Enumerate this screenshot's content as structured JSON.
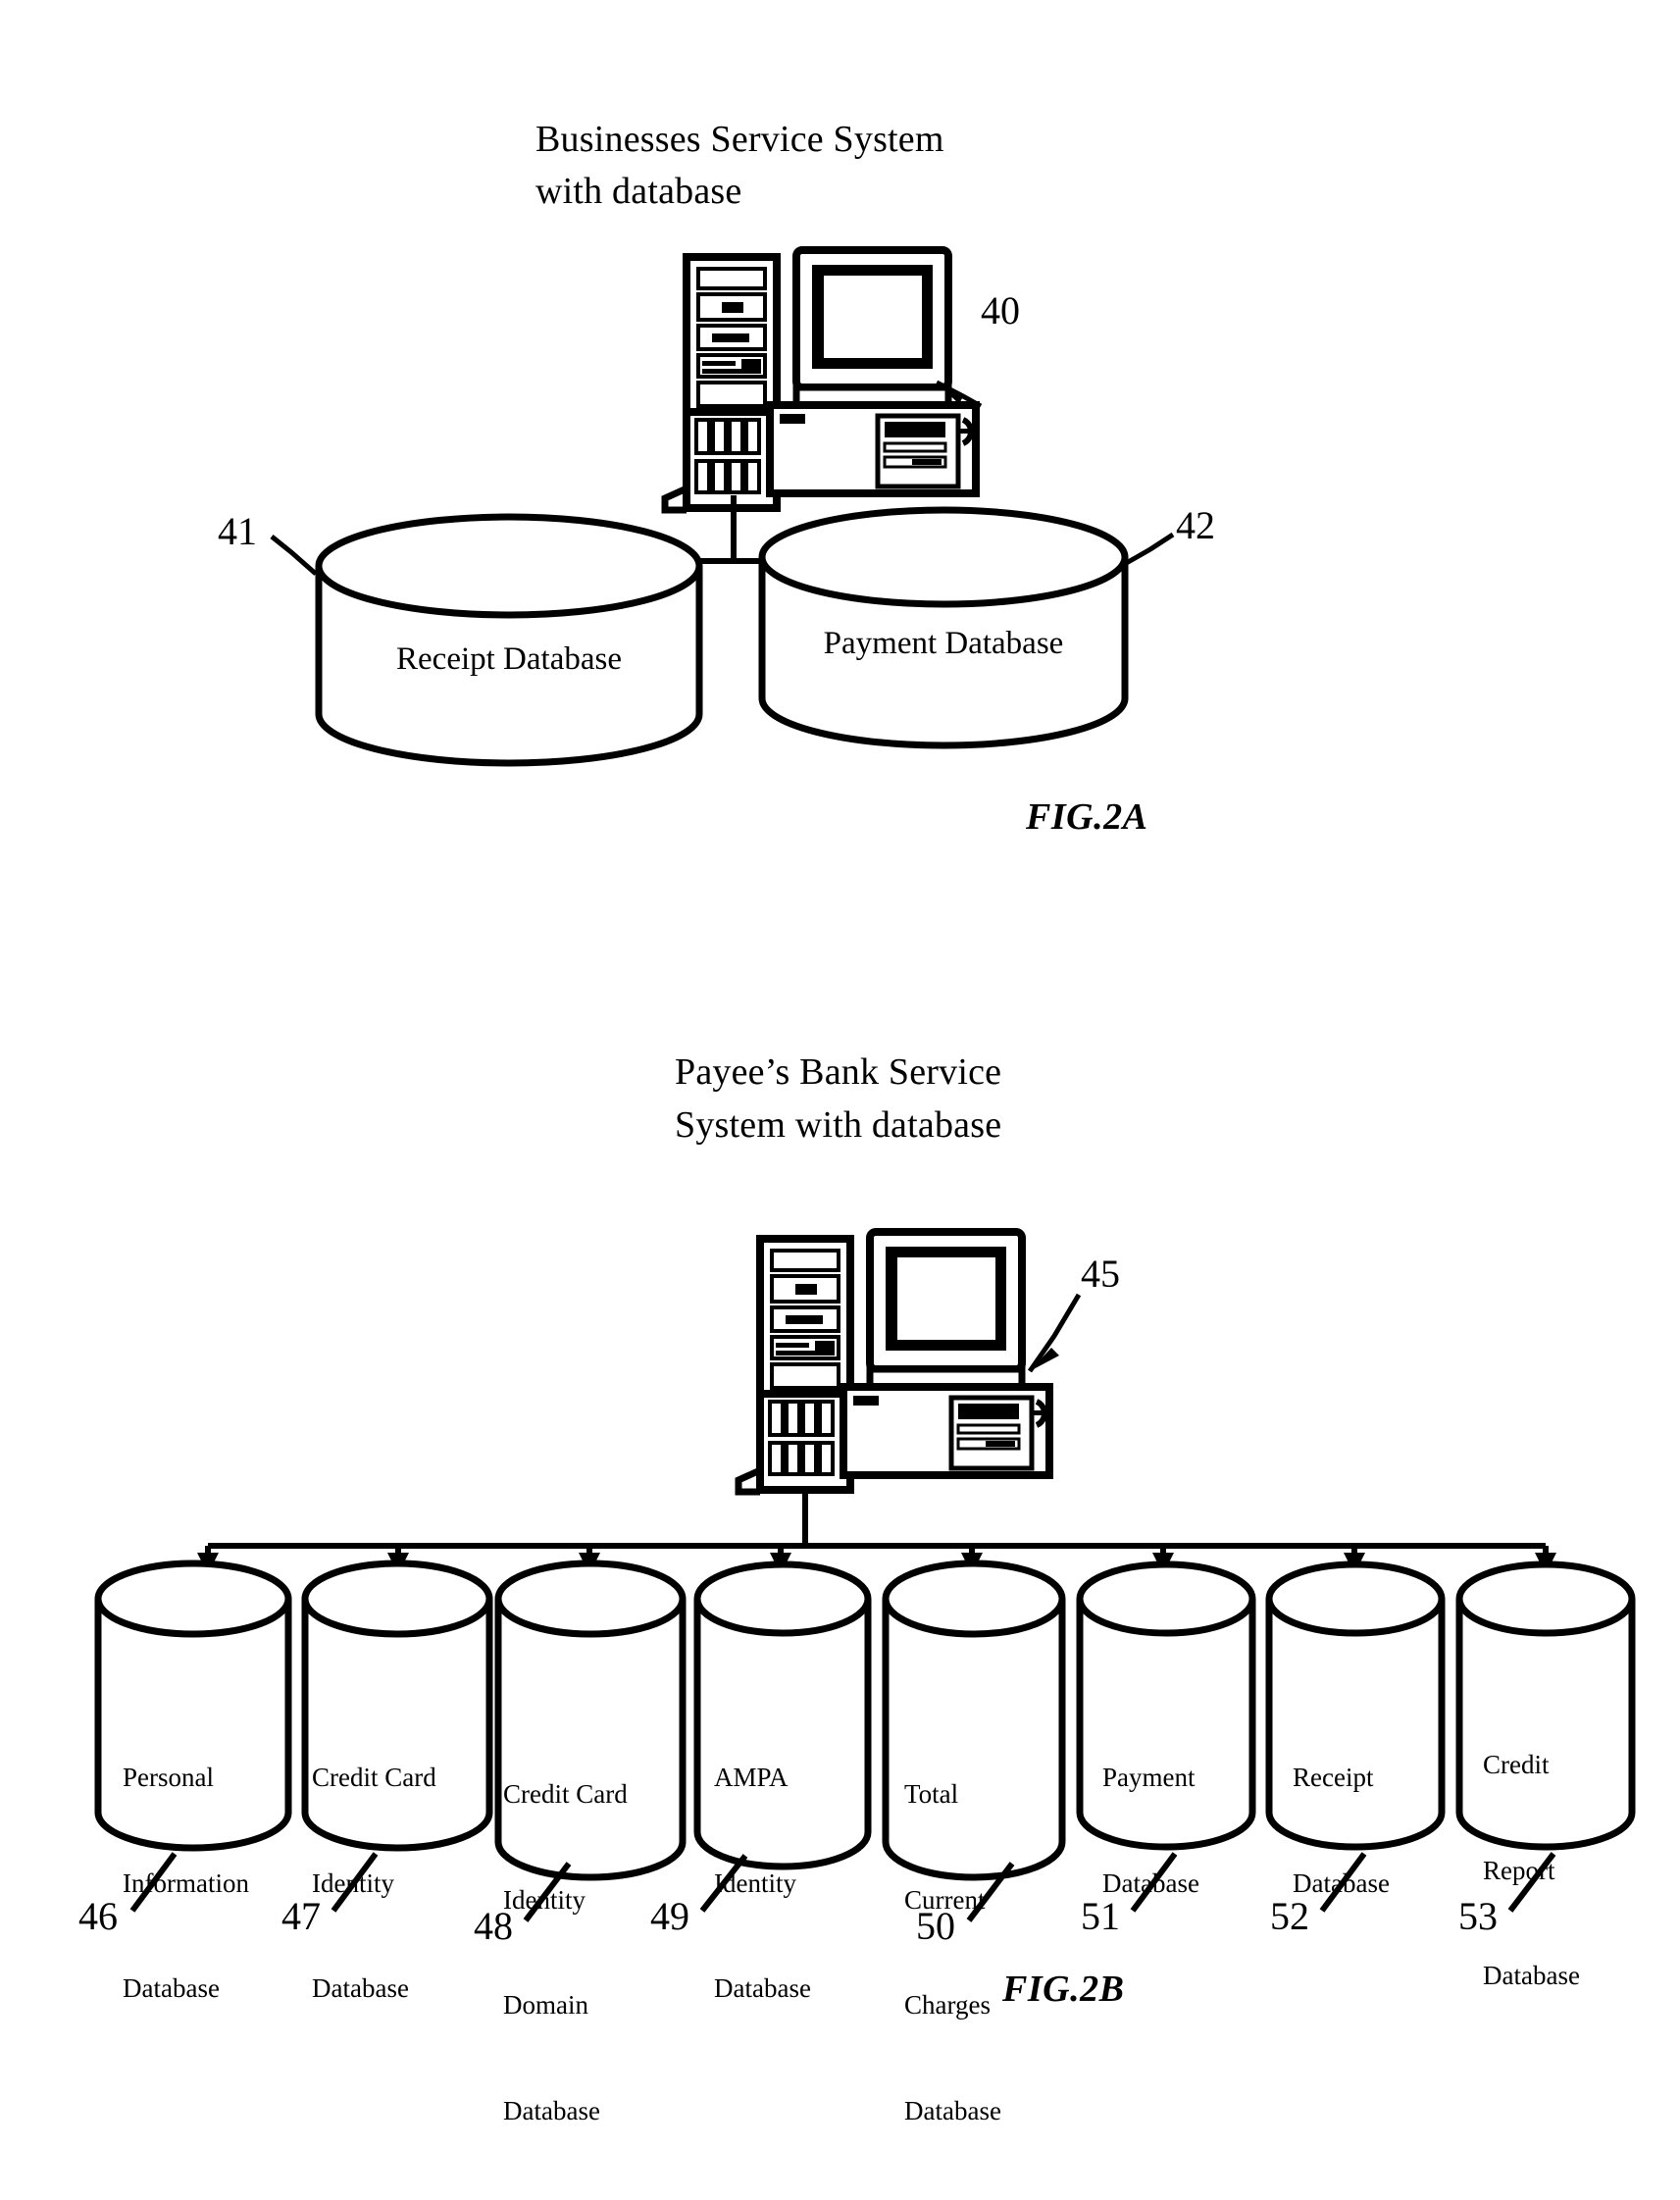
{
  "figures": [
    {
      "id": "fig-2a",
      "caption": "FIG.2A",
      "title_line1": "Businesses Service System",
      "title_line2": "with database",
      "system_ref": "40",
      "computer_icon": "server-computer-icon",
      "databases": [
        {
          "ref": "41",
          "label": "Receipt Database"
        },
        {
          "ref": "42",
          "label": "Payment Database"
        }
      ]
    },
    {
      "id": "fig-2b",
      "caption": "FIG.2B",
      "title_line1": "Payee’s Bank Service",
      "title_line2": "System with database",
      "system_ref": "45",
      "computer_icon": "server-computer-icon",
      "databases": [
        {
          "ref": "46",
          "lines": [
            "Personal",
            "Information",
            "Database"
          ]
        },
        {
          "ref": "47",
          "lines": [
            "Credit Card",
            "Identity",
            "Database"
          ]
        },
        {
          "ref": "48",
          "lines": [
            "Credit Card",
            "Identity",
            "Domain",
            "Database"
          ]
        },
        {
          "ref": "49",
          "lines": [
            "AMPA",
            "Identity",
            "Database"
          ]
        },
        {
          "ref": "50",
          "lines": [
            "Total",
            "Current",
            "Charges",
            "Database"
          ]
        },
        {
          "ref": "51",
          "lines": [
            "Payment",
            "Database"
          ]
        },
        {
          "ref": "52",
          "lines": [
            "Receipt",
            "Database"
          ]
        },
        {
          "ref": "53",
          "lines": [
            "Credit",
            "Report",
            "Database"
          ]
        }
      ]
    }
  ],
  "colors": {
    "ink": "#000000",
    "paper": "#ffffff"
  }
}
